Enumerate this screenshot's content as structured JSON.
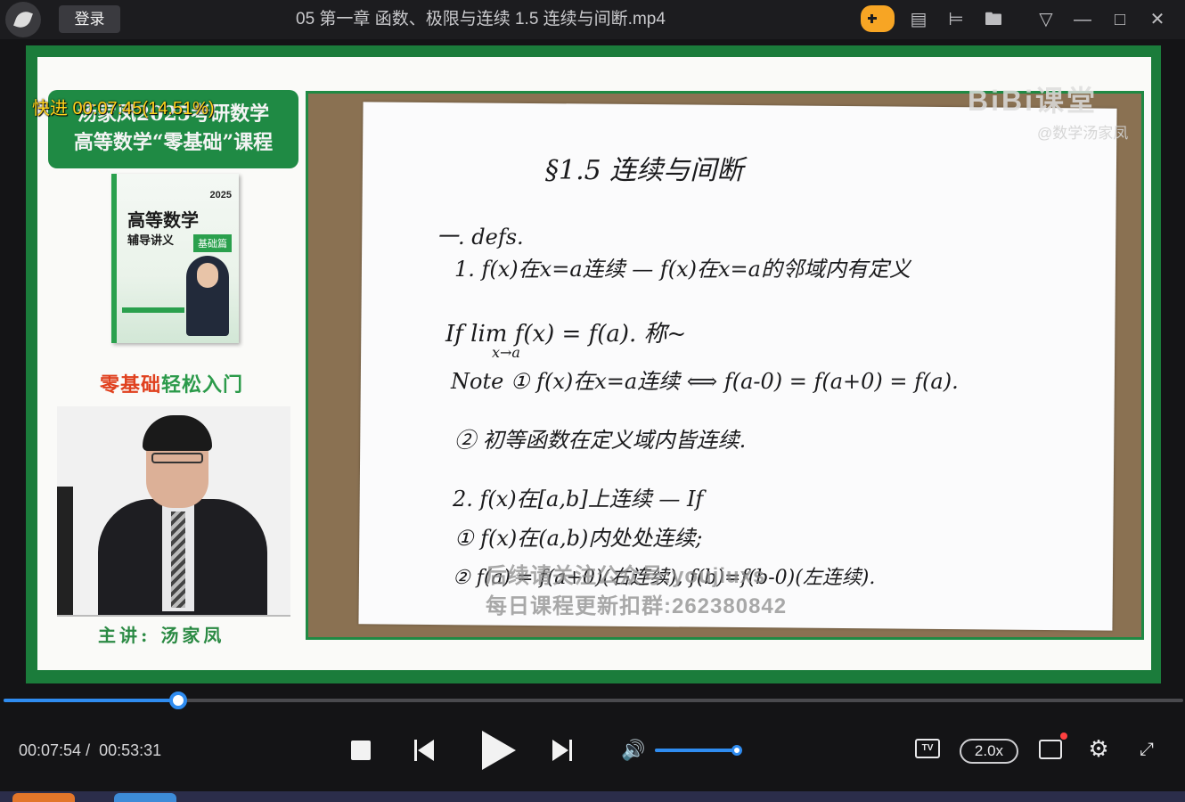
{
  "titlebar": {
    "login_label": "登录",
    "title": "05 第一章 函数、极限与连续 1.5 连续与间断.mp4",
    "icons": [
      "game-icon",
      "note-icon",
      "pin-icon",
      "folder-icon",
      "menu-icon",
      "minimize-icon",
      "maximize-icon",
      "close-icon"
    ],
    "accent_color": "#f7a524"
  },
  "overlay": {
    "fast_forward": "快进 00:07:45(14.51%)"
  },
  "slide": {
    "course_line1": "汤家凤2025考研数学",
    "course_line2": "高等数学“零基础”课程",
    "book_year": "2025",
    "book_title": "高等数学",
    "book_subtitle": "辅导讲义",
    "book_badge": "基础篇",
    "slogan_part1": "零基础",
    "slogan_part2": "轻松入门",
    "lecturer": "主讲: 汤家凤",
    "brand": "BiBi课堂",
    "brand_user": "@数学汤家凤",
    "accent_green": "#1f8a44"
  },
  "notes": {
    "heading": "§1.5 连续与间断",
    "line1": "一. defs.",
    "line2": "1. f(x)在x=a连续 — f(x)在x=a的邻域内有定义",
    "line3": "If lim f(x) = f(a). 称~",
    "line3_sub": "x→a",
    "line4": "Note ① f(x)在x=a连续 ⟺ f(a-0) = f(a+0) = f(a).",
    "line5": "② 初等函数在定义域内皆连续.",
    "line6": "2. f(x)在[a,b]上连续 — If",
    "line7": "① f(x)在(a,b)内处处连续;",
    "line8": "② f(a) = f(a+0)(右连续), f(b)=f(b-0)(左连续)."
  },
  "watermark": {
    "line1": "后续请关注公众号:youjiuxs",
    "line2": "每日课程更新扣群:262380842"
  },
  "controls": {
    "current_time": "00:07:54",
    "separator": "/",
    "total_time": "00:53:31",
    "progress": 0.148,
    "volume": 1.0,
    "speed_label": "2.0x",
    "tv_label": "TV",
    "progress_color": "#2f8cf0"
  }
}
